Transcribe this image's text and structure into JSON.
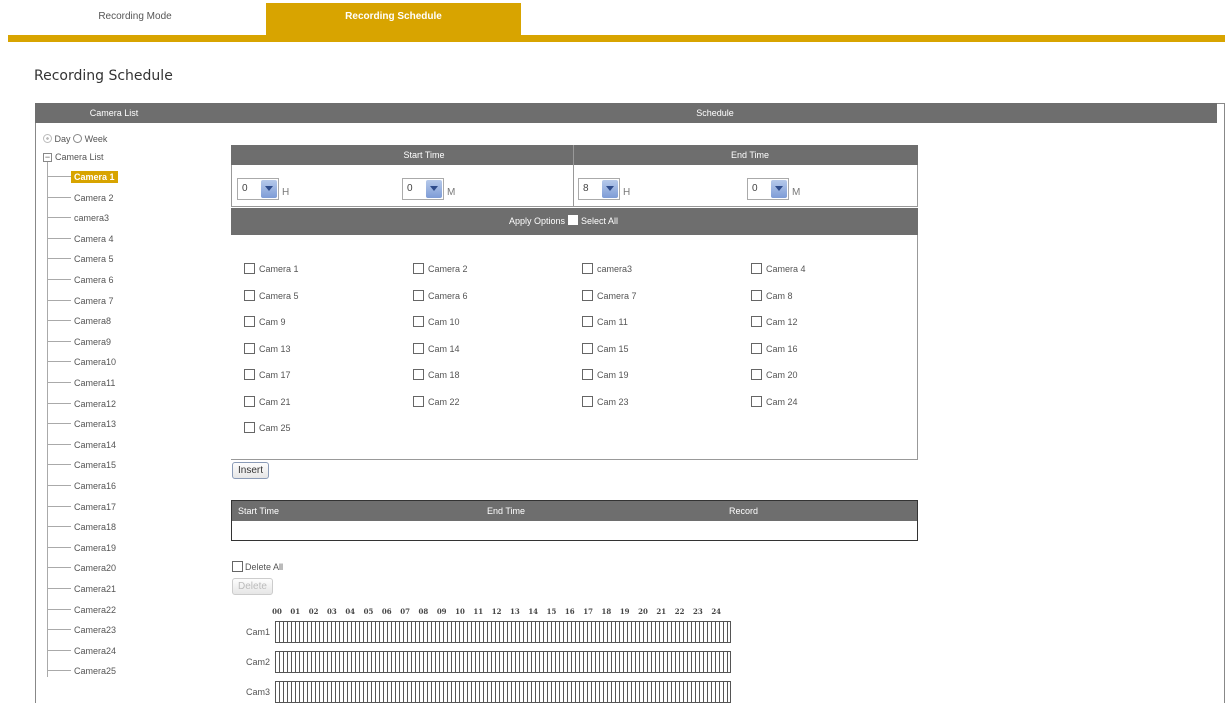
{
  "tabs": {
    "recording_mode": "Recording Mode",
    "recording_schedule": "Recording Schedule"
  },
  "page_title": "Recording Schedule",
  "header": {
    "camera_list": "Camera List",
    "schedule": "Schedule"
  },
  "view": {
    "day": "Day",
    "week": "Week",
    "selected": "Day"
  },
  "tree": {
    "root_label": "Camera List",
    "items": [
      "Camera 1",
      "Camera 2",
      "camera3",
      "Camera 4",
      "Camera 5",
      "Camera 6",
      "Camera 7",
      "Camera8",
      "Camera9",
      "Camera10",
      "Camera11",
      "Camera12",
      "Camera13",
      "Camera14",
      "Camera15",
      "Camera16",
      "Camera17",
      "Camera18",
      "Camera19",
      "Camera20",
      "Camera21",
      "Camera22",
      "Camera23",
      "Camera24",
      "Camera25"
    ],
    "active": "Camera 1"
  },
  "time": {
    "start_label": "Start Time",
    "end_label": "End Time",
    "start_h": "0",
    "start_m": "0",
    "end_h": "8",
    "end_m": "0",
    "h_unit": "H",
    "m_unit": "M"
  },
  "apply": {
    "label": "Apply Options",
    "select_all": "Select All"
  },
  "apply_cameras": [
    "Camera 1",
    "Camera 2",
    "camera3",
    "Camera 4",
    "Camera 5",
    "Camera 6",
    "Camera 7",
    "Cam 8",
    "Cam 9",
    "Cam 10",
    "Cam 11",
    "Cam 12",
    "Cam 13",
    "Cam 14",
    "Cam 15",
    "Cam 16",
    "Cam 17",
    "Cam 18",
    "Cam 19",
    "Cam 20",
    "Cam 21",
    "Cam 22",
    "Cam 23",
    "Cam 24",
    "Cam 25"
  ],
  "insert_label": "Insert",
  "schedule_table": {
    "start": "Start Time",
    "end": "End Time",
    "record": "Record"
  },
  "delete_all_label": "Delete All",
  "delete_label": "Delete",
  "hours": [
    "00",
    "01",
    "02",
    "03",
    "04",
    "05",
    "06",
    "07",
    "08",
    "09",
    "10",
    "11",
    "12",
    "13",
    "14",
    "15",
    "16",
    "17",
    "18",
    "19",
    "20",
    "21",
    "22",
    "23",
    "24"
  ],
  "timeline_rows": [
    "Cam1",
    "Cam2",
    "Cam3"
  ],
  "colors": {
    "accent": "#d8a400",
    "header_gray": "#6e6e6e"
  }
}
